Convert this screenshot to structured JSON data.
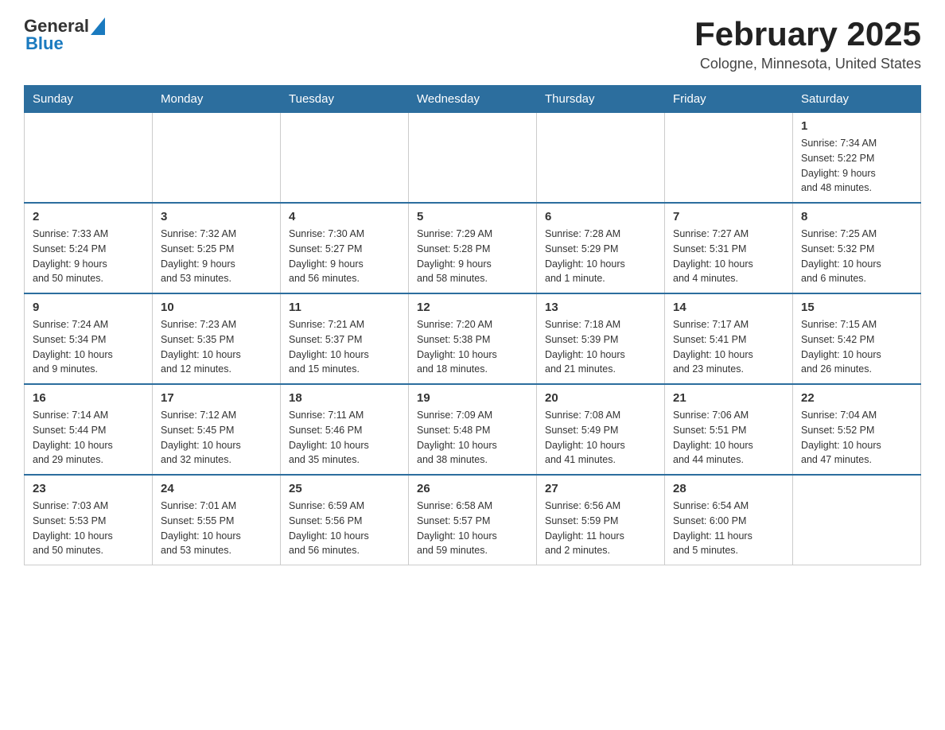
{
  "header": {
    "logo_general": "General",
    "logo_blue": "Blue",
    "month_title": "February 2025",
    "location": "Cologne, Minnesota, United States"
  },
  "weekdays": [
    "Sunday",
    "Monday",
    "Tuesday",
    "Wednesday",
    "Thursday",
    "Friday",
    "Saturday"
  ],
  "weeks": [
    [
      {
        "day": "",
        "info": ""
      },
      {
        "day": "",
        "info": ""
      },
      {
        "day": "",
        "info": ""
      },
      {
        "day": "",
        "info": ""
      },
      {
        "day": "",
        "info": ""
      },
      {
        "day": "",
        "info": ""
      },
      {
        "day": "1",
        "info": "Sunrise: 7:34 AM\nSunset: 5:22 PM\nDaylight: 9 hours\nand 48 minutes."
      }
    ],
    [
      {
        "day": "2",
        "info": "Sunrise: 7:33 AM\nSunset: 5:24 PM\nDaylight: 9 hours\nand 50 minutes."
      },
      {
        "day": "3",
        "info": "Sunrise: 7:32 AM\nSunset: 5:25 PM\nDaylight: 9 hours\nand 53 minutes."
      },
      {
        "day": "4",
        "info": "Sunrise: 7:30 AM\nSunset: 5:27 PM\nDaylight: 9 hours\nand 56 minutes."
      },
      {
        "day": "5",
        "info": "Sunrise: 7:29 AM\nSunset: 5:28 PM\nDaylight: 9 hours\nand 58 minutes."
      },
      {
        "day": "6",
        "info": "Sunrise: 7:28 AM\nSunset: 5:29 PM\nDaylight: 10 hours\nand 1 minute."
      },
      {
        "day": "7",
        "info": "Sunrise: 7:27 AM\nSunset: 5:31 PM\nDaylight: 10 hours\nand 4 minutes."
      },
      {
        "day": "8",
        "info": "Sunrise: 7:25 AM\nSunset: 5:32 PM\nDaylight: 10 hours\nand 6 minutes."
      }
    ],
    [
      {
        "day": "9",
        "info": "Sunrise: 7:24 AM\nSunset: 5:34 PM\nDaylight: 10 hours\nand 9 minutes."
      },
      {
        "day": "10",
        "info": "Sunrise: 7:23 AM\nSunset: 5:35 PM\nDaylight: 10 hours\nand 12 minutes."
      },
      {
        "day": "11",
        "info": "Sunrise: 7:21 AM\nSunset: 5:37 PM\nDaylight: 10 hours\nand 15 minutes."
      },
      {
        "day": "12",
        "info": "Sunrise: 7:20 AM\nSunset: 5:38 PM\nDaylight: 10 hours\nand 18 minutes."
      },
      {
        "day": "13",
        "info": "Sunrise: 7:18 AM\nSunset: 5:39 PM\nDaylight: 10 hours\nand 21 minutes."
      },
      {
        "day": "14",
        "info": "Sunrise: 7:17 AM\nSunset: 5:41 PM\nDaylight: 10 hours\nand 23 minutes."
      },
      {
        "day": "15",
        "info": "Sunrise: 7:15 AM\nSunset: 5:42 PM\nDaylight: 10 hours\nand 26 minutes."
      }
    ],
    [
      {
        "day": "16",
        "info": "Sunrise: 7:14 AM\nSunset: 5:44 PM\nDaylight: 10 hours\nand 29 minutes."
      },
      {
        "day": "17",
        "info": "Sunrise: 7:12 AM\nSunset: 5:45 PM\nDaylight: 10 hours\nand 32 minutes."
      },
      {
        "day": "18",
        "info": "Sunrise: 7:11 AM\nSunset: 5:46 PM\nDaylight: 10 hours\nand 35 minutes."
      },
      {
        "day": "19",
        "info": "Sunrise: 7:09 AM\nSunset: 5:48 PM\nDaylight: 10 hours\nand 38 minutes."
      },
      {
        "day": "20",
        "info": "Sunrise: 7:08 AM\nSunset: 5:49 PM\nDaylight: 10 hours\nand 41 minutes."
      },
      {
        "day": "21",
        "info": "Sunrise: 7:06 AM\nSunset: 5:51 PM\nDaylight: 10 hours\nand 44 minutes."
      },
      {
        "day": "22",
        "info": "Sunrise: 7:04 AM\nSunset: 5:52 PM\nDaylight: 10 hours\nand 47 minutes."
      }
    ],
    [
      {
        "day": "23",
        "info": "Sunrise: 7:03 AM\nSunset: 5:53 PM\nDaylight: 10 hours\nand 50 minutes."
      },
      {
        "day": "24",
        "info": "Sunrise: 7:01 AM\nSunset: 5:55 PM\nDaylight: 10 hours\nand 53 minutes."
      },
      {
        "day": "25",
        "info": "Sunrise: 6:59 AM\nSunset: 5:56 PM\nDaylight: 10 hours\nand 56 minutes."
      },
      {
        "day": "26",
        "info": "Sunrise: 6:58 AM\nSunset: 5:57 PM\nDaylight: 10 hours\nand 59 minutes."
      },
      {
        "day": "27",
        "info": "Sunrise: 6:56 AM\nSunset: 5:59 PM\nDaylight: 11 hours\nand 2 minutes."
      },
      {
        "day": "28",
        "info": "Sunrise: 6:54 AM\nSunset: 6:00 PM\nDaylight: 11 hours\nand 5 minutes."
      },
      {
        "day": "",
        "info": ""
      }
    ]
  ]
}
